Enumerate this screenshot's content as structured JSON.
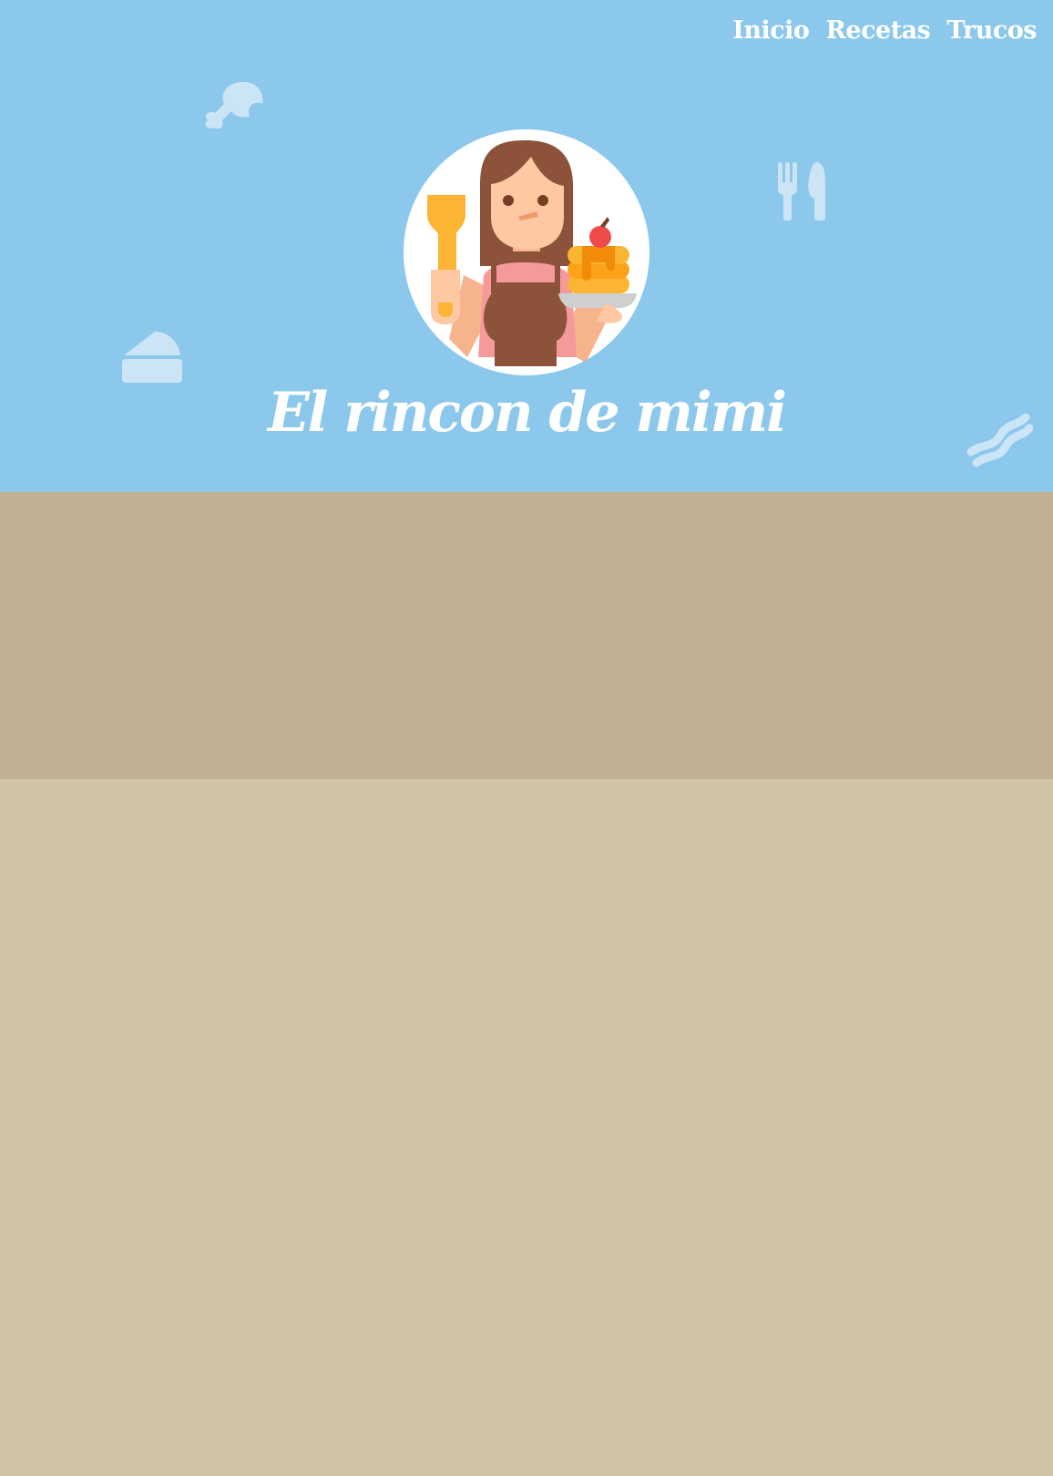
{
  "colors": {
    "hero_bg": "#8bc8ec",
    "band1": "#c0b193",
    "band2": "#cfc5a5",
    "text": "#ffffff"
  },
  "nav": [
    {
      "label": "Inicio"
    },
    {
      "label": "Recetas"
    },
    {
      "label": "Trucos"
    }
  ],
  "site_title": "El rincon de mimi",
  "icons": [
    "chicken-leg-icon",
    "fork-knife-icon",
    "cake-slice-icon",
    "bacon-icon",
    "chef-avatar-icon"
  ]
}
